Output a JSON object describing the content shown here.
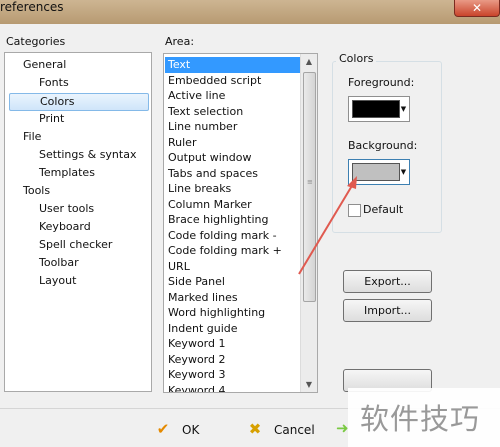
{
  "window": {
    "title": "references",
    "close_glyph": "✕"
  },
  "categories": {
    "label": "Categories",
    "items": [
      {
        "label": "General",
        "level": 0
      },
      {
        "label": "Fonts",
        "level": 1
      },
      {
        "label": "Colors",
        "level": 1,
        "selected": true
      },
      {
        "label": "Print",
        "level": 1
      },
      {
        "label": "File",
        "level": 0
      },
      {
        "label": "Settings & syntax",
        "level": 1
      },
      {
        "label": "Templates",
        "level": 1
      },
      {
        "label": "Tools",
        "level": 0
      },
      {
        "label": "User tools",
        "level": 1
      },
      {
        "label": "Keyboard",
        "level": 1
      },
      {
        "label": "Spell checker",
        "level": 1
      },
      {
        "label": "Toolbar",
        "level": 1
      },
      {
        "label": "Layout",
        "level": 1
      }
    ]
  },
  "area": {
    "label": "Area:",
    "items": [
      "Text",
      "Embedded script",
      "Active line",
      "Text selection",
      "Line number",
      "Ruler",
      "Output window",
      "Tabs and spaces",
      "Line breaks",
      "Column Marker",
      "Brace highlighting",
      "Code folding mark -",
      "Code folding mark +",
      "URL",
      "Side Panel",
      "Marked lines",
      "Word highlighting",
      "Indent guide",
      "Keyword 1",
      "Keyword 2",
      "Keyword 3",
      "Keyword 4"
    ],
    "selected_index": 0
  },
  "colors": {
    "group_label": "Colors",
    "foreground_label": "Foreground:",
    "foreground_color": "#000000",
    "background_label": "Background:",
    "background_color": "#c0c0c0",
    "default_label": "Default",
    "default_checked": false
  },
  "buttons": {
    "export": "Export...",
    "import": "Import...",
    "ok": "OK",
    "cancel": "Cancel"
  },
  "watermark": "软件技巧",
  "accent_colors": {
    "selection": "#3399ff",
    "arrow": "#e05a50"
  }
}
